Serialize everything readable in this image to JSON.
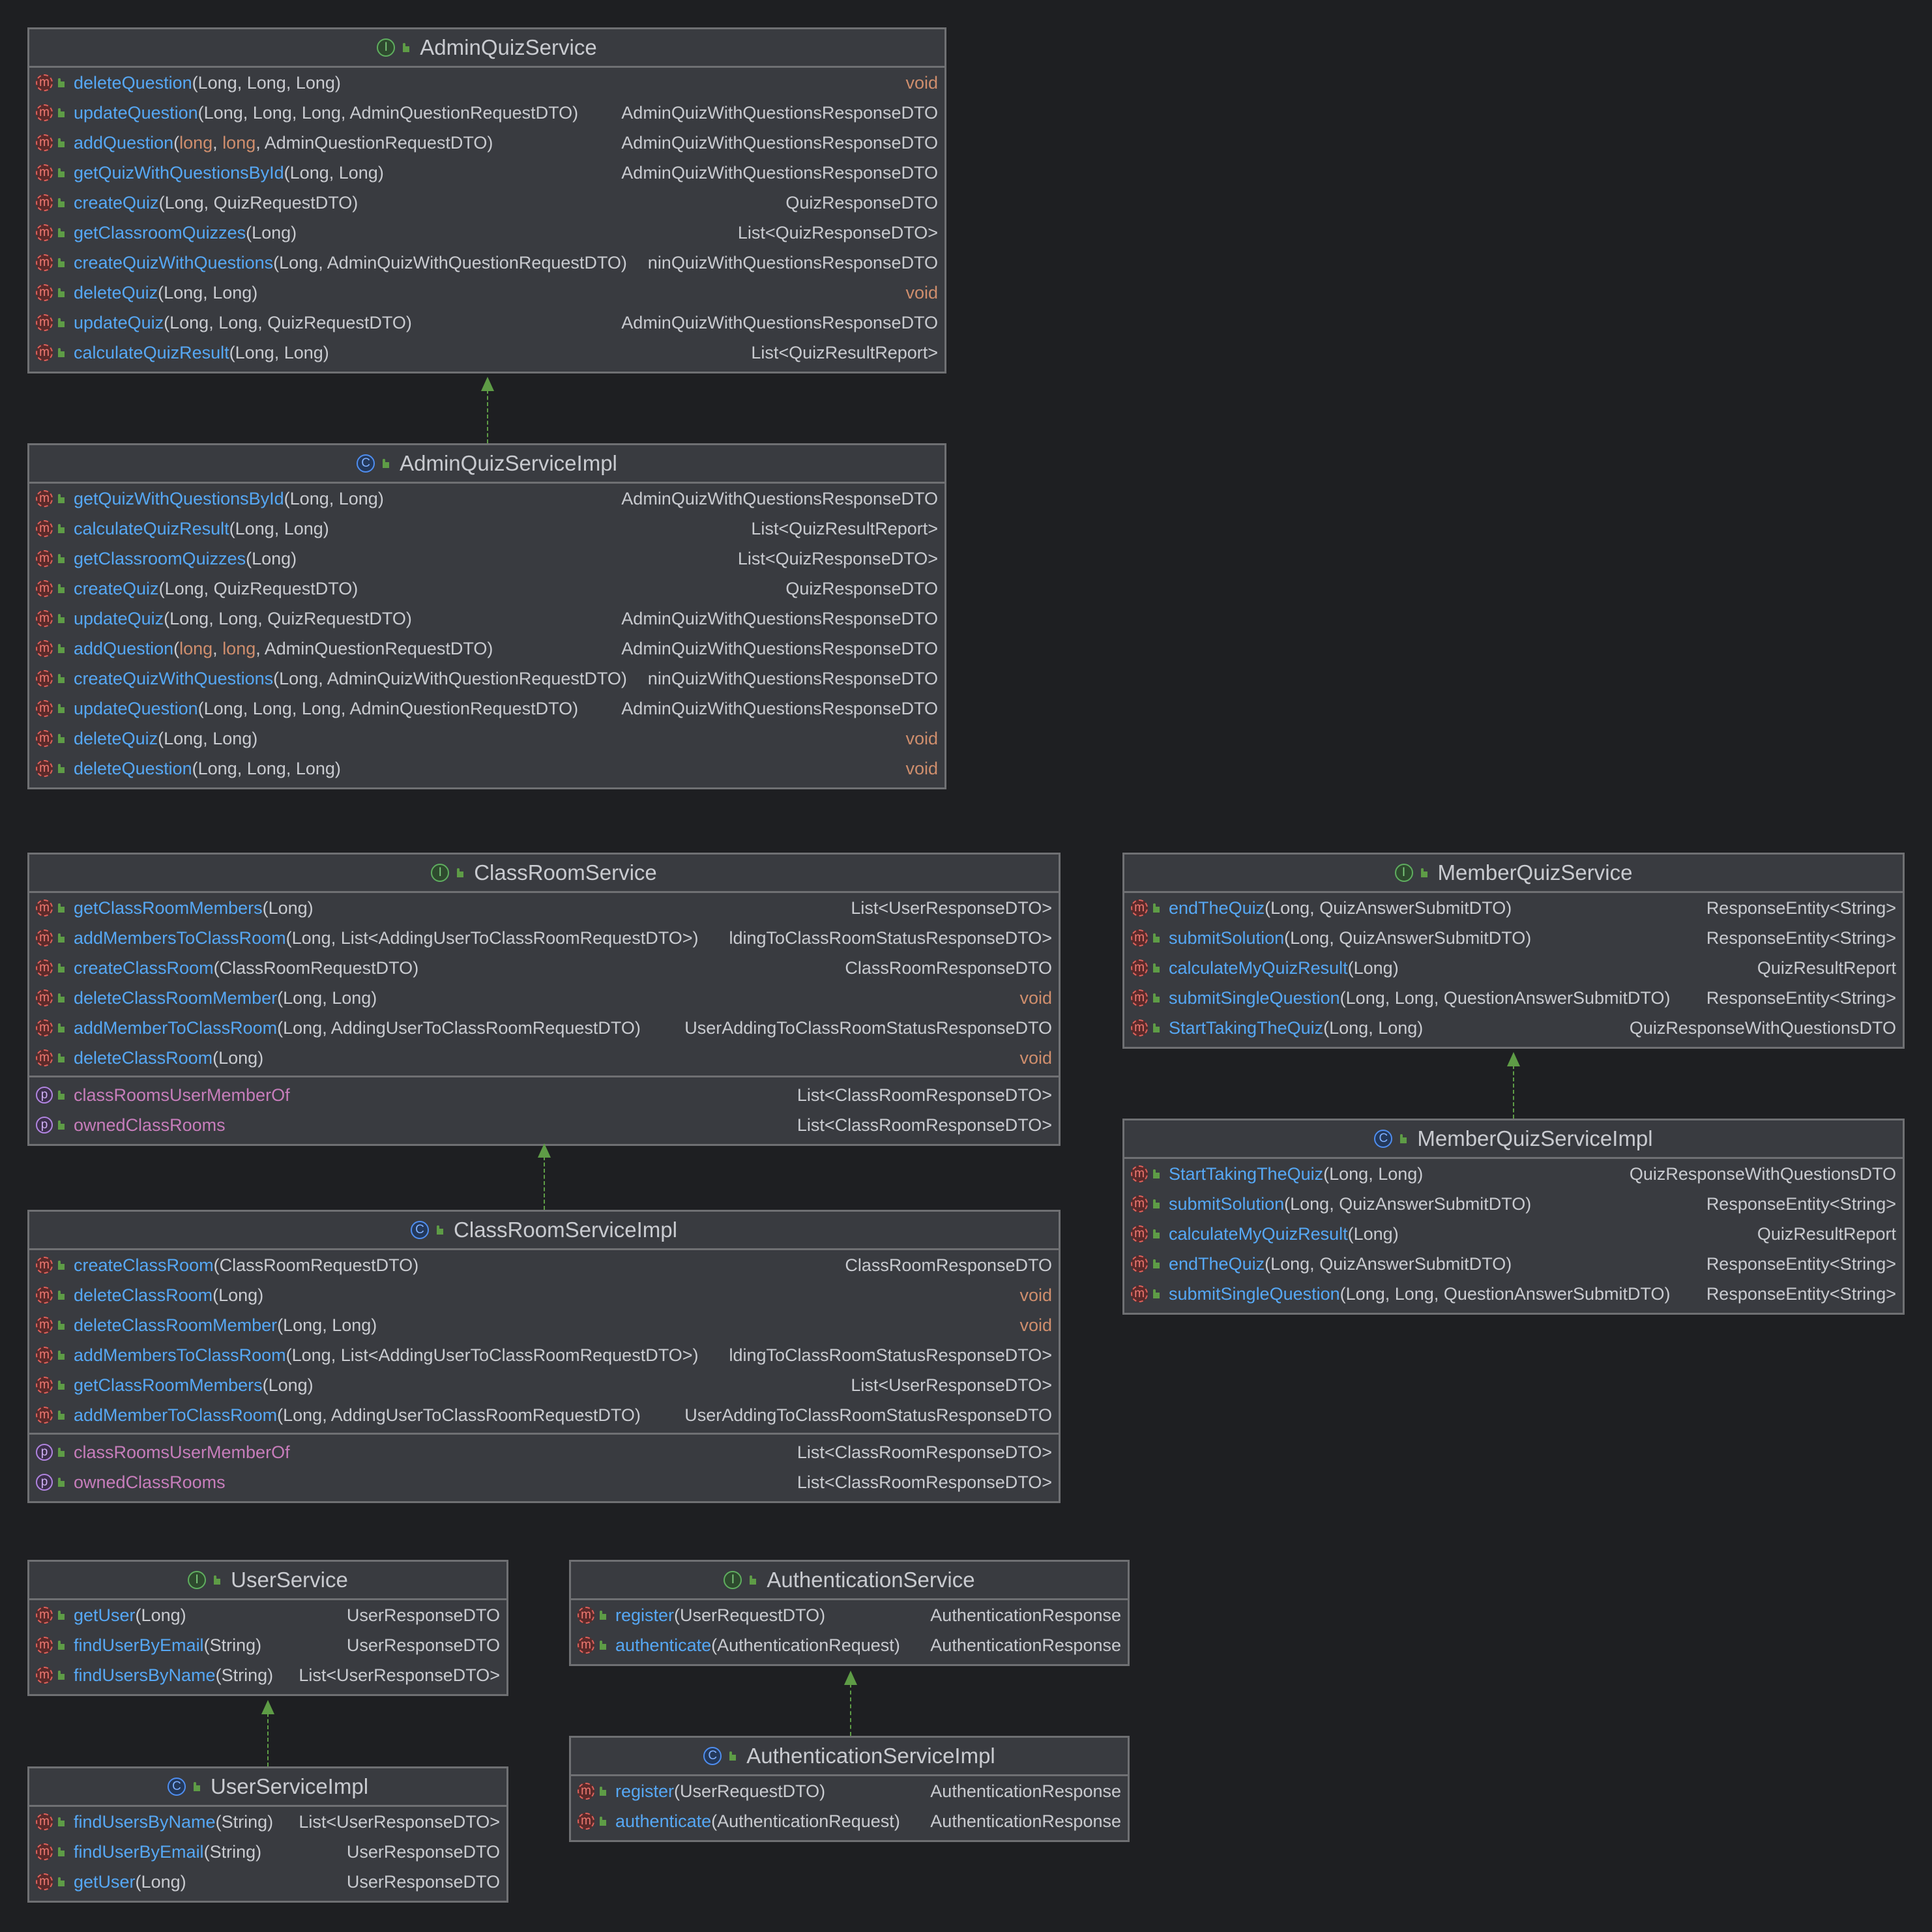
{
  "diagrams": [
    {
      "name": "AdminQuizService",
      "kind": "interface",
      "methods": [
        {
          "name": "deleteQuestion",
          "params": "Long, Long, Long",
          "ret": "void"
        },
        {
          "name": "updateQuestion",
          "params": "Long, Long, Long, AdminQuestionRequestDTO",
          "ret": "AdminQuizWithQuestionsResponseDTO"
        },
        {
          "name": "addQuestion",
          "params": "long, long, AdminQuestionRequestDTO",
          "ret": "AdminQuizWithQuestionsResponseDTO"
        },
        {
          "name": "getQuizWithQuestionsById",
          "params": "Long, Long",
          "ret": "AdminQuizWithQuestionsResponseDTO"
        },
        {
          "name": "createQuiz",
          "params": "Long, QuizRequestDTO",
          "ret": "QuizResponseDTO"
        },
        {
          "name": "getClassroomQuizzes",
          "params": "Long",
          "ret": "List<QuizResponseDTO>"
        },
        {
          "name": "createQuizWithQuestions",
          "params": "Long, AdminQuizWithQuestionRequestDTO",
          "ret": "ninQuizWithQuestionsResponseDTO"
        },
        {
          "name": "deleteQuiz",
          "params": "Long, Long",
          "ret": "void"
        },
        {
          "name": "updateQuiz",
          "params": "Long, Long, QuizRequestDTO",
          "ret": "AdminQuizWithQuestionsResponseDTO"
        },
        {
          "name": "calculateQuizResult",
          "params": "Long, Long",
          "ret": "List<QuizResultReport>"
        }
      ],
      "props": []
    },
    {
      "name": "AdminQuizServiceImpl",
      "kind": "class",
      "methods": [
        {
          "name": "getQuizWithQuestionsById",
          "params": "Long, Long",
          "ret": "AdminQuizWithQuestionsResponseDTO"
        },
        {
          "name": "calculateQuizResult",
          "params": "Long, Long",
          "ret": "List<QuizResultReport>"
        },
        {
          "name": "getClassroomQuizzes",
          "params": "Long",
          "ret": "List<QuizResponseDTO>"
        },
        {
          "name": "createQuiz",
          "params": "Long, QuizRequestDTO",
          "ret": "QuizResponseDTO"
        },
        {
          "name": "updateQuiz",
          "params": "Long, Long, QuizRequestDTO",
          "ret": "AdminQuizWithQuestionsResponseDTO"
        },
        {
          "name": "addQuestion",
          "params": "long, long, AdminQuestionRequestDTO",
          "ret": "AdminQuizWithQuestionsResponseDTO"
        },
        {
          "name": "createQuizWithQuestions",
          "params": "Long, AdminQuizWithQuestionRequestDTO",
          "ret": "ninQuizWithQuestionsResponseDTO"
        },
        {
          "name": "updateQuestion",
          "params": "Long, Long, Long, AdminQuestionRequestDTO",
          "ret": "AdminQuizWithQuestionsResponseDTO"
        },
        {
          "name": "deleteQuiz",
          "params": "Long, Long",
          "ret": "void"
        },
        {
          "name": "deleteQuestion",
          "params": "Long, Long, Long",
          "ret": "void"
        }
      ],
      "props": []
    },
    {
      "name": "ClassRoomService",
      "kind": "interface",
      "methods": [
        {
          "name": "getClassRoomMembers",
          "params": "Long",
          "ret": "List<UserResponseDTO>"
        },
        {
          "name": "addMembersToClassRoom",
          "params": "Long, List<AddingUserToClassRoomRequestDTO>",
          "ret": "ldingToClassRoomStatusResponseDTO>"
        },
        {
          "name": "createClassRoom",
          "params": "ClassRoomRequestDTO",
          "ret": "ClassRoomResponseDTO"
        },
        {
          "name": "deleteClassRoomMember",
          "params": "Long, Long",
          "ret": "void"
        },
        {
          "name": "addMemberToClassRoom",
          "params": "Long, AddingUserToClassRoomRequestDTO",
          "ret": "UserAddingToClassRoomStatusResponseDTO"
        },
        {
          "name": "deleteClassRoom",
          "params": "Long",
          "ret": "void"
        }
      ],
      "props": [
        {
          "name": "classRoomsUserMemberOf",
          "ret": "List<ClassRoomResponseDTO>"
        },
        {
          "name": "ownedClassRooms",
          "ret": "List<ClassRoomResponseDTO>"
        }
      ]
    },
    {
      "name": "ClassRoomServiceImpl",
      "kind": "class",
      "methods": [
        {
          "name": "createClassRoom",
          "params": "ClassRoomRequestDTO",
          "ret": "ClassRoomResponseDTO"
        },
        {
          "name": "deleteClassRoom",
          "params": "Long",
          "ret": "void"
        },
        {
          "name": "deleteClassRoomMember",
          "params": "Long, Long",
          "ret": "void"
        },
        {
          "name": "addMembersToClassRoom",
          "params": "Long, List<AddingUserToClassRoomRequestDTO>",
          "ret": "ldingToClassRoomStatusResponseDTO>"
        },
        {
          "name": "getClassRoomMembers",
          "params": "Long",
          "ret": "List<UserResponseDTO>"
        },
        {
          "name": "addMemberToClassRoom",
          "params": "Long, AddingUserToClassRoomRequestDTO",
          "ret": "UserAddingToClassRoomStatusResponseDTO"
        }
      ],
      "props": [
        {
          "name": "classRoomsUserMemberOf",
          "ret": "List<ClassRoomResponseDTO>"
        },
        {
          "name": "ownedClassRooms",
          "ret": "List<ClassRoomResponseDTO>"
        }
      ]
    },
    {
      "name": "MemberQuizService",
      "kind": "interface",
      "methods": [
        {
          "name": "endTheQuiz",
          "params": "Long, QuizAnswerSubmitDTO",
          "ret": "ResponseEntity<String>"
        },
        {
          "name": "submitSolution",
          "params": "Long, QuizAnswerSubmitDTO",
          "ret": "ResponseEntity<String>"
        },
        {
          "name": "calculateMyQuizResult",
          "params": "Long",
          "ret": "QuizResultReport"
        },
        {
          "name": "submitSingleQuestion",
          "params": "Long, Long, QuestionAnswerSubmitDTO",
          "ret": "ResponseEntity<String>"
        },
        {
          "name": "StartTakingTheQuiz",
          "params": "Long, Long",
          "ret": "QuizResponseWithQuestionsDTO"
        }
      ],
      "props": []
    },
    {
      "name": "MemberQuizServiceImpl",
      "kind": "class",
      "methods": [
        {
          "name": "StartTakingTheQuiz",
          "params": "Long, Long",
          "ret": "QuizResponseWithQuestionsDTO"
        },
        {
          "name": "submitSolution",
          "params": "Long, QuizAnswerSubmitDTO",
          "ret": "ResponseEntity<String>"
        },
        {
          "name": "calculateMyQuizResult",
          "params": "Long",
          "ret": "QuizResultReport"
        },
        {
          "name": "endTheQuiz",
          "params": "Long, QuizAnswerSubmitDTO",
          "ret": "ResponseEntity<String>"
        },
        {
          "name": "submitSingleQuestion",
          "params": "Long, Long, QuestionAnswerSubmitDTO",
          "ret": "ResponseEntity<String>"
        }
      ],
      "props": []
    },
    {
      "name": "UserService",
      "kind": "interface",
      "methods": [
        {
          "name": "getUser",
          "params": "Long",
          "ret": "UserResponseDTO"
        },
        {
          "name": "findUserByEmail",
          "params": "String",
          "ret": "UserResponseDTO"
        },
        {
          "name": "findUsersByName",
          "params": "String",
          "ret": "List<UserResponseDTO>"
        }
      ],
      "props": []
    },
    {
      "name": "UserServiceImpl",
      "kind": "class",
      "methods": [
        {
          "name": "findUsersByName",
          "params": "String",
          "ret": "List<UserResponseDTO>"
        },
        {
          "name": "findUserByEmail",
          "params": "String",
          "ret": "UserResponseDTO"
        },
        {
          "name": "getUser",
          "params": "Long",
          "ret": "UserResponseDTO"
        }
      ],
      "props": []
    },
    {
      "name": "AuthenticationService",
      "kind": "interface",
      "methods": [
        {
          "name": "register",
          "params": "UserRequestDTO",
          "ret": "AuthenticationResponse"
        },
        {
          "name": "authenticate",
          "params": "AuthenticationRequest",
          "ret": "AuthenticationResponse"
        }
      ],
      "props": []
    },
    {
      "name": "AuthenticationServiceImpl",
      "kind": "class",
      "methods": [
        {
          "name": "register",
          "params": "UserRequestDTO",
          "ret": "AuthenticationResponse"
        },
        {
          "name": "authenticate",
          "params": "AuthenticationRequest",
          "ret": "AuthenticationResponse"
        }
      ],
      "props": []
    }
  ],
  "icons": {
    "interface": "I",
    "class": "C",
    "method": "m",
    "property": "p"
  },
  "colors": {
    "background": "#1e1f22",
    "box": "#393b40",
    "method": "#56a8f5",
    "property": "#c77dbb",
    "keyword": "#cf8e6d",
    "arrow": "#5e9c46"
  }
}
